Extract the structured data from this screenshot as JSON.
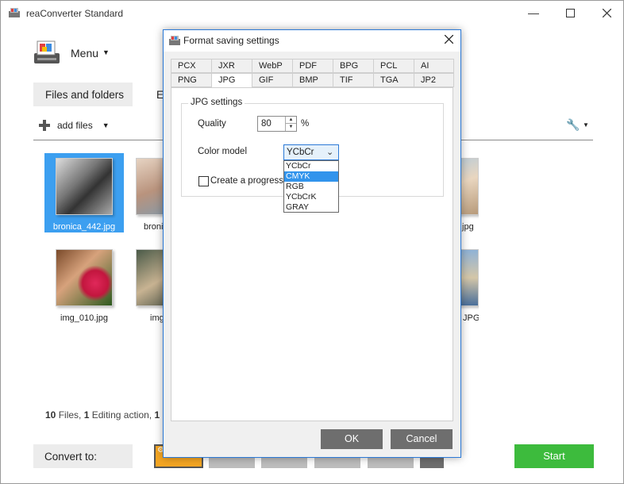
{
  "app": {
    "title": "reaConverter Standard",
    "menu_label": "Menu",
    "tabs": {
      "files": "Files and folders",
      "edit_partial": "E"
    },
    "add_files": "add files",
    "thumbnails": [
      {
        "caption": "bronica_442.jpg",
        "selected": true
      },
      {
        "caption": "broni",
        "selected": false
      },
      {
        "caption": ".jpg",
        "selected": false
      },
      {
        "caption": "img_010.jpg",
        "selected": false
      },
      {
        "caption": "img",
        "selected": false
      },
      {
        "caption": "JPG",
        "selected": false
      }
    ],
    "status": {
      "files_count": "10",
      "files_label": "Files,",
      "editing_count": "1",
      "editing_label": "Editing action,",
      "tail_count": "1"
    },
    "convert_to": "Convert to:",
    "start": "Start",
    "colors": {
      "accent": "#3c9ff0",
      "start": "#3dbb3d",
      "format_active": "#f5a623"
    }
  },
  "dialog": {
    "title": "Format saving settings",
    "tabs_top": [
      "PCX",
      "JXR",
      "WebP",
      "PDF",
      "BPG",
      "PCL",
      "AI"
    ],
    "tabs_bottom": [
      "PNG",
      "JPG",
      "GIF",
      "BMP",
      "TIF",
      "TGA",
      "JP2"
    ],
    "active_tab": "JPG",
    "group_title": "JPG settings",
    "quality_label": "Quality",
    "quality_value": "80",
    "quality_unit": "%",
    "color_model_label": "Color model",
    "color_model_value": "YCbCr",
    "color_model_options": [
      "YCbCr",
      "CMYK",
      "RGB",
      "YCbCrK",
      "GRAY"
    ],
    "highlighted_option": "CMYK",
    "progressive_label": "Create a progress",
    "ok": "OK",
    "cancel": "Cancel"
  }
}
